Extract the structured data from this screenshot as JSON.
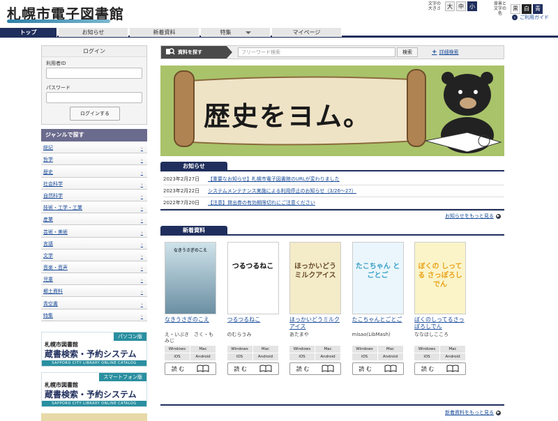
{
  "header": {
    "logo": "札幌市電子図書館",
    "font_size_label": "文字の大きさ",
    "font_sizes": [
      "大",
      "中",
      "小"
    ],
    "bg_label": "背景と文字の色",
    "bg_colors": [
      "黒",
      "白",
      "青"
    ],
    "guide": "ご利用ガイド"
  },
  "nav": {
    "items": [
      "トップ",
      "お知らせ",
      "新着資料",
      "特集",
      "マイページ"
    ]
  },
  "login": {
    "title": "ログイン",
    "user_label": "利用者ID",
    "password_label": "パスワード",
    "button": "ログインする"
  },
  "genre": {
    "title": "ジャンルで探す",
    "items": [
      "総記",
      "哲学",
      "歴史",
      "社会科学",
      "自然科学",
      "技術・工学・工業",
      "産業",
      "芸術・美術",
      "言語",
      "文学",
      "音楽・音声",
      "児童",
      "郷土資料",
      "青空書",
      "特集"
    ]
  },
  "banners": [
    {
      "tag": "パソコン版",
      "line1": "札幌市図書館",
      "line2": "蔵書検索・予約システム",
      "strip": "SAPPORO CITY LIBRARY ONLINE CATALOG"
    },
    {
      "tag": "スマートフォン版",
      "line1": "札幌市図書館",
      "line2": "蔵書検索・予約システム",
      "strip": "SAPPORO CITY LIBRARY ONLINE CATALOG"
    }
  ],
  "search": {
    "label": "資料を探す",
    "placeholder": "フリーワード検索",
    "button": "検索",
    "advanced": "詳細検索"
  },
  "hero": {
    "text": "歴史をヨム。"
  },
  "news": {
    "title": "お知らせ",
    "items": [
      {
        "date": "2023年2月27日",
        "title": "【重要なお知らせ】札幌市電子図書館のURLが変わりました"
      },
      {
        "date": "2023年2月22日",
        "title": "システムメンテナンス実施による利用停止のお知らせ（3/26～27）"
      },
      {
        "date": "2022年7月20日",
        "title": "【注意】貸出券の有効期限切れにご注意ください"
      }
    ],
    "more": "お知らせをもっと見る"
  },
  "new_books": {
    "title": "新着資料",
    "more": "新着資料をもっと見る",
    "read_label": "読 む",
    "platforms": [
      "Windows",
      "Mac",
      "iOS",
      "Android"
    ],
    "items": [
      {
        "title": "なきうさぎのこえ",
        "author": "え・いぶき　さく・もみじ",
        "cover_text": "なきうさぎのこえ"
      },
      {
        "title": "つるつるねこ",
        "author": "のむらうみ",
        "cover_text": "つるつるねこ"
      },
      {
        "title": "ほっかいどうミルクアイス",
        "author": "あたまや",
        "cover_text": "ほっかいどう ミルクアイス"
      },
      {
        "title": "たこちゃんとごとご",
        "author": "misao(LibMash)",
        "cover_text": "たこちゃん とごとご"
      },
      {
        "title": "ぼくのしってるさっぽろしでん",
        "author": "ななほしこころ",
        "cover_text": "ぼくの しってる さっぽろしでん"
      }
    ]
  }
}
